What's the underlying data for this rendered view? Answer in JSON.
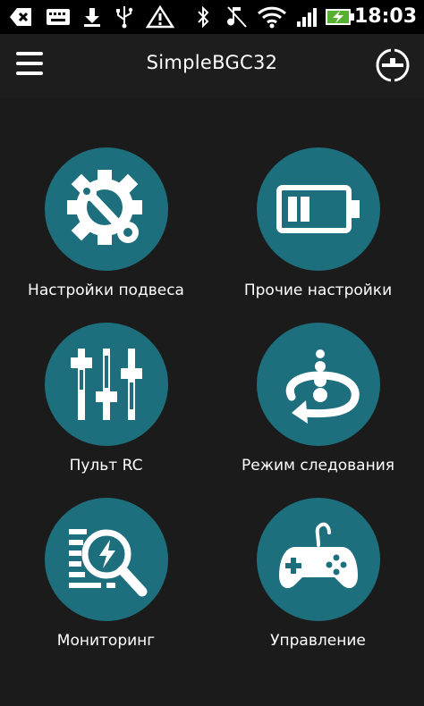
{
  "status_bar": {
    "time": "18:03",
    "icons": [
      "back-arrow-icon",
      "keyboard-icon",
      "download-icon",
      "usb-icon",
      "warning-icon",
      "bluetooth-icon",
      "silent-icon",
      "wifi-icon",
      "signal-icon",
      "battery-charging-icon"
    ]
  },
  "app_bar": {
    "title": "SimpleBGC32",
    "menu_icon": "hamburger-menu-icon",
    "connect_icon": "connection-icon"
  },
  "menu": {
    "tiles": [
      {
        "label": "Настройки подвеса",
        "icon": "gear-wrench-icon"
      },
      {
        "label": "Прочие настройки",
        "icon": "battery-icon"
      },
      {
        "label": "Пульт RC",
        "icon": "sliders-icon"
      },
      {
        "label": "Режим следования",
        "icon": "follow-mode-icon"
      },
      {
        "label": "Мониторинг",
        "icon": "monitoring-magnifier-icon"
      },
      {
        "label": "Управление",
        "icon": "gamepad-icon"
      }
    ]
  },
  "colors": {
    "accent": "#1d6f7d",
    "background": "#1b1b1b",
    "status_bar": "#000000"
  }
}
